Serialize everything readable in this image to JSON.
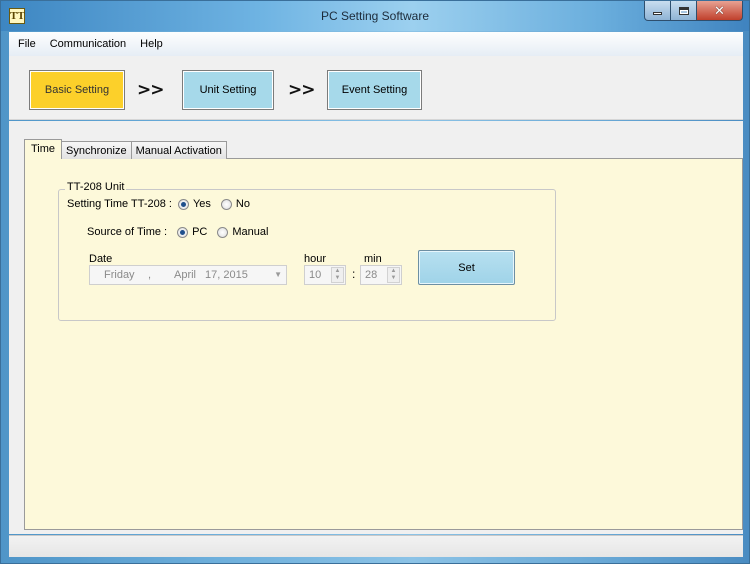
{
  "window": {
    "title": "PC Setting Software",
    "icon_text": "TT"
  },
  "menu": {
    "items": [
      "File",
      "Communication",
      "Help"
    ]
  },
  "steps": {
    "basic": "Basic Setting",
    "arrow": ">>",
    "unit": "Unit Setting",
    "event": "Event Setting",
    "active": "Basic Setting",
    "colors": {
      "active": "#fcd02a",
      "inactive": "#a6d9ea"
    }
  },
  "tabs": {
    "items": [
      "Time",
      "Synchronize",
      "Manual Activation"
    ],
    "active": "Time"
  },
  "group": {
    "title": "TT-208 Unit",
    "setting_time_label": "Setting Time TT-208 :",
    "yes_label": "Yes",
    "no_label": "No",
    "setting_time_value": "Yes",
    "source_label": "Source of Time :",
    "pc_label": "PC",
    "manual_label": "Manual",
    "source_value": "PC",
    "date_label": "Date",
    "date_weekday": "Friday",
    "date_sep": ",",
    "date_month": "April",
    "date_day_year": "17, 2015",
    "hour_label": "hour",
    "hour_value": "10",
    "min_label": "min",
    "min_value": "28",
    "colon": ":",
    "set_button": "Set"
  },
  "icons": {
    "dropdown": "chevron-down-icon",
    "spin_up": "up-arrow-icon",
    "spin_down": "down-arrow-icon"
  }
}
